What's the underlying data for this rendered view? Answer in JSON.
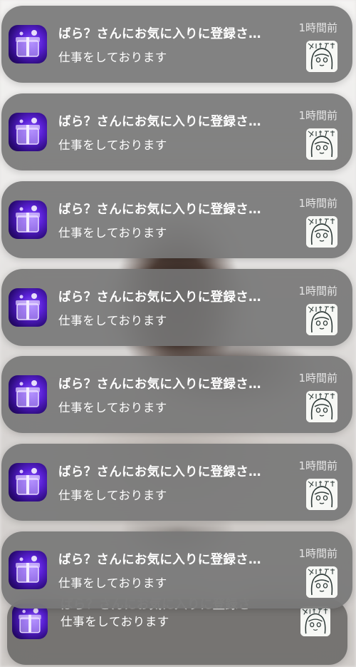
{
  "notifications": [
    {
      "title": "ばら？さんにお気に入りに登録さ…",
      "body": "仕事をしております",
      "time": "1時間前",
      "app_icon": "purple-gift-app-icon",
      "thumbnail": "manga-girl-sticker"
    },
    {
      "title": "ばら？さんにお気に入りに登録さ…",
      "body": "仕事をしております",
      "time": "1時間前",
      "app_icon": "purple-gift-app-icon",
      "thumbnail": "manga-girl-sticker"
    },
    {
      "title": "ばら？さんにお気に入りに登録さ…",
      "body": "仕事をしております",
      "time": "1時間前",
      "app_icon": "purple-gift-app-icon",
      "thumbnail": "manga-girl-sticker"
    },
    {
      "title": "ばら？さんにお気に入りに登録さ…",
      "body": "仕事をしております",
      "time": "1時間前",
      "app_icon": "purple-gift-app-icon",
      "thumbnail": "manga-girl-sticker"
    },
    {
      "title": "ばら？さんにお気に入りに登録さ…",
      "body": "仕事をしております",
      "time": "1時間前",
      "app_icon": "purple-gift-app-icon",
      "thumbnail": "manga-girl-sticker"
    },
    {
      "title": "ばら？さんにお気に入りに登録さ…",
      "body": "仕事をしております",
      "time": "1時間前",
      "app_icon": "purple-gift-app-icon",
      "thumbnail": "manga-girl-sticker"
    },
    {
      "title": "ばら？さんにお気に入りに登録さ…",
      "body": "仕事をしております",
      "time": "1時間前",
      "app_icon": "purple-gift-app-icon",
      "thumbnail": "manga-girl-sticker"
    }
  ],
  "stacked_notification": {
    "title": "ばら？さんにお気に入りに登録さ",
    "body": "仕事をしております",
    "app_icon": "purple-gift-app-icon",
    "thumbnail": "manga-girl-sticker"
  },
  "colors": {
    "notification_bg": "#767676",
    "text": "#ffffff",
    "app_icon_purple": "#5a21d6"
  }
}
